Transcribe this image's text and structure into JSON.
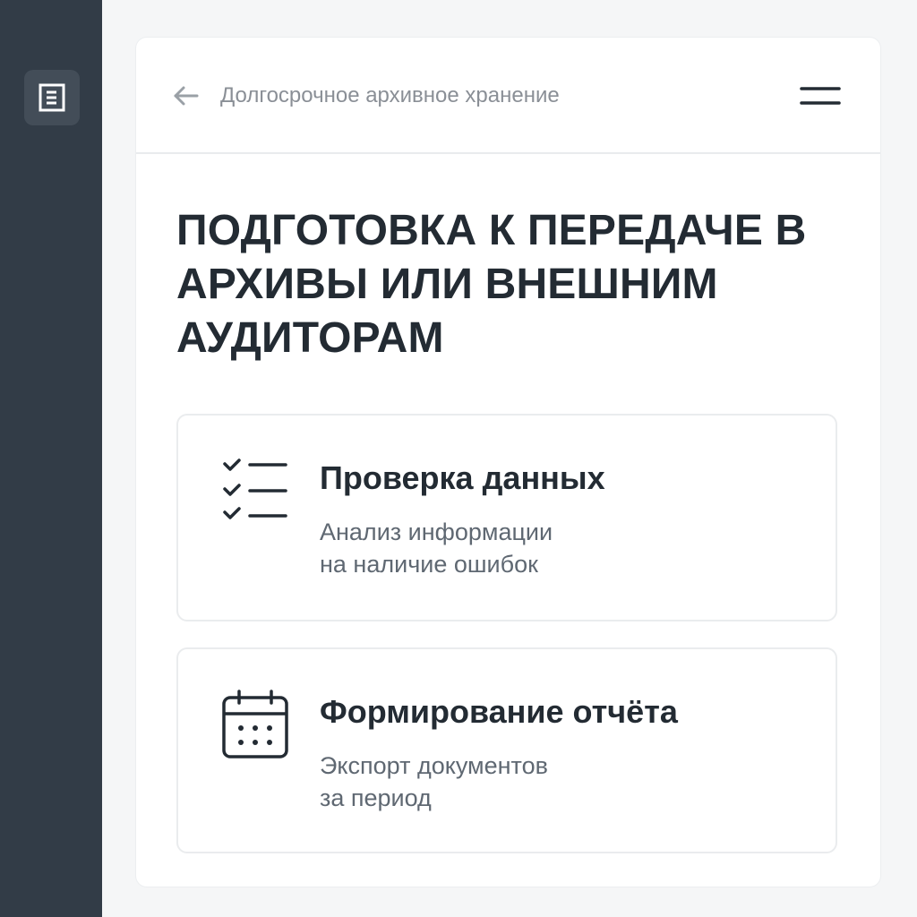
{
  "sidebar": {
    "logo_icon": "document-list-icon"
  },
  "header": {
    "back_icon": "arrow-left-icon",
    "breadcrumb": "Долгосрочное архивное хранение",
    "menu_icon": "hamburger-menu-icon"
  },
  "main": {
    "title": "ПОДГОТОВКА К ПЕРЕДАЧЕ В АРХИВЫ ИЛИ ВНЕШНИМ АУДИТОРАМ",
    "features": [
      {
        "icon": "checklist-icon",
        "title": "Проверка данных",
        "desc_line1": "Анализ информации",
        "desc_line2": "на наличие ошибок"
      },
      {
        "icon": "calendar-icon",
        "title": "Формирование отчёта",
        "desc_line1": "Экспорт документов",
        "desc_line2": "за период"
      }
    ]
  },
  "colors": {
    "sidebar_bg": "#323c47",
    "text_primary": "#232b33",
    "text_secondary": "#5f6872",
    "breadcrumb": "#8a8f96"
  }
}
